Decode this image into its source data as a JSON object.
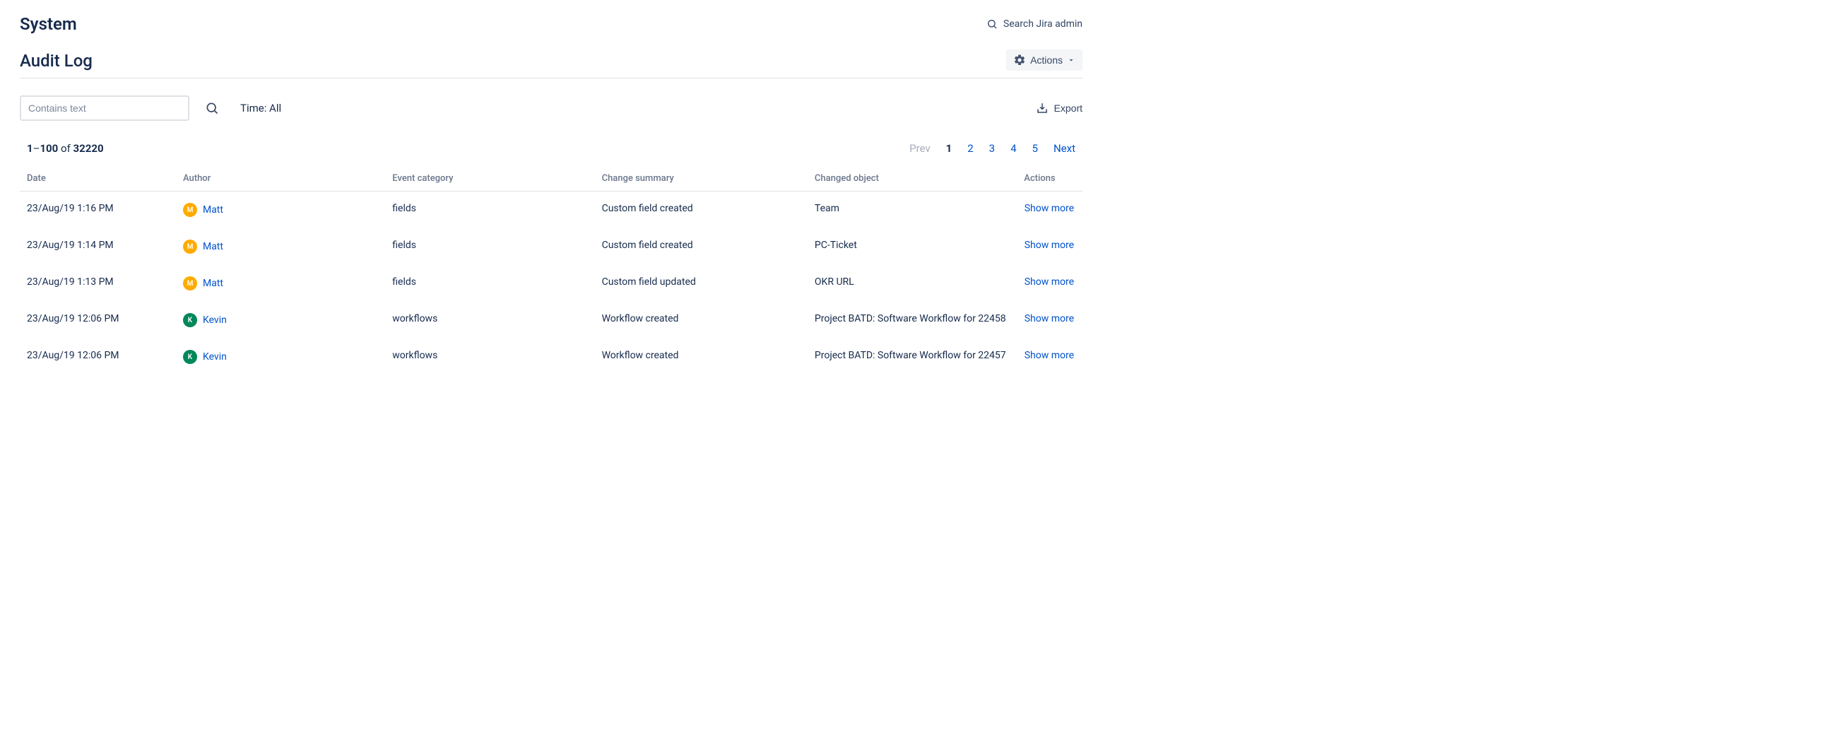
{
  "header": {
    "system_title": "System",
    "search_admin_label": "Search Jira admin",
    "page_title": "Audit Log",
    "actions_label": "Actions"
  },
  "filters": {
    "text_placeholder": "Contains text",
    "time_label": "Time: All",
    "export_label": "Export"
  },
  "results": {
    "range_start": "1",
    "range_end": "100",
    "of_word": "of",
    "total": "32220"
  },
  "pagination": {
    "prev_label": "Prev",
    "next_label": "Next",
    "pages": [
      "1",
      "2",
      "3",
      "4",
      "5"
    ],
    "current": "1"
  },
  "table": {
    "headers": {
      "date": "Date",
      "author": "Author",
      "category": "Event category",
      "summary": "Change summary",
      "object": "Changed object",
      "actions": "Actions"
    },
    "show_more_label": "Show more",
    "rows": [
      {
        "date": "23/Aug/19 1:16 PM",
        "author": "Matt",
        "avatar_color": "#FFAB00",
        "category": "fields",
        "summary": "Custom field created",
        "object": "Team"
      },
      {
        "date": "23/Aug/19 1:14 PM",
        "author": "Matt",
        "avatar_color": "#FFAB00",
        "category": "fields",
        "summary": "Custom field created",
        "object": "PC-Ticket"
      },
      {
        "date": "23/Aug/19 1:13 PM",
        "author": "Matt",
        "avatar_color": "#FFAB00",
        "category": "fields",
        "summary": "Custom field updated",
        "object": "OKR URL"
      },
      {
        "date": "23/Aug/19 12:06 PM",
        "author": "Kevin",
        "avatar_color": "#00875A",
        "category": "workflows",
        "summary": "Workflow created",
        "object": "Project BATD: Software Workflow for 22458"
      },
      {
        "date": "23/Aug/19 12:06 PM",
        "author": "Kevin",
        "avatar_color": "#00875A",
        "category": "workflows",
        "summary": "Workflow created",
        "object": "Project BATD: Software Workflow for 22457"
      }
    ]
  }
}
